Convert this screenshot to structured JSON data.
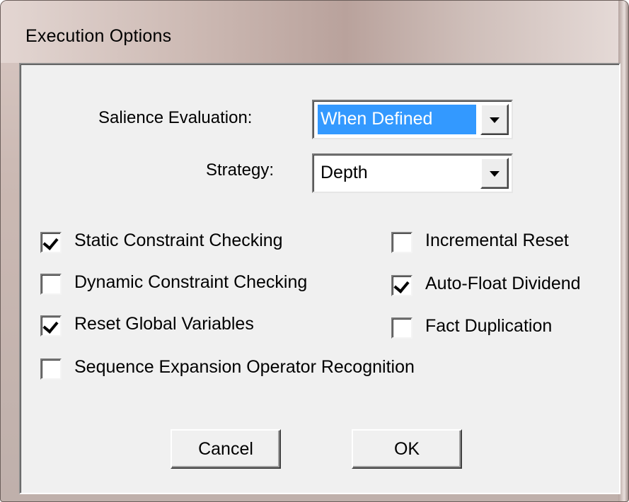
{
  "window": {
    "title": "Execution Options"
  },
  "salience": {
    "label": "Salience Evaluation:",
    "value": "When Defined"
  },
  "strategy": {
    "label": "Strategy:",
    "value": "Depth"
  },
  "options": {
    "static_constraint": {
      "label": "Static Constraint Checking",
      "checked": true
    },
    "dynamic_constraint": {
      "label": "Dynamic Constraint Checking",
      "checked": false
    },
    "reset_globals": {
      "label": "Reset Global Variables",
      "checked": true
    },
    "sequence_expansion": {
      "label": "Sequence Expansion Operator Recognition",
      "checked": false
    },
    "incremental_reset": {
      "label": "Incremental Reset",
      "checked": false
    },
    "auto_float": {
      "label": "Auto-Float Dividend",
      "checked": true
    },
    "fact_duplication": {
      "label": "Fact Duplication",
      "checked": false
    }
  },
  "buttons": {
    "cancel": "Cancel",
    "ok": "OK"
  }
}
